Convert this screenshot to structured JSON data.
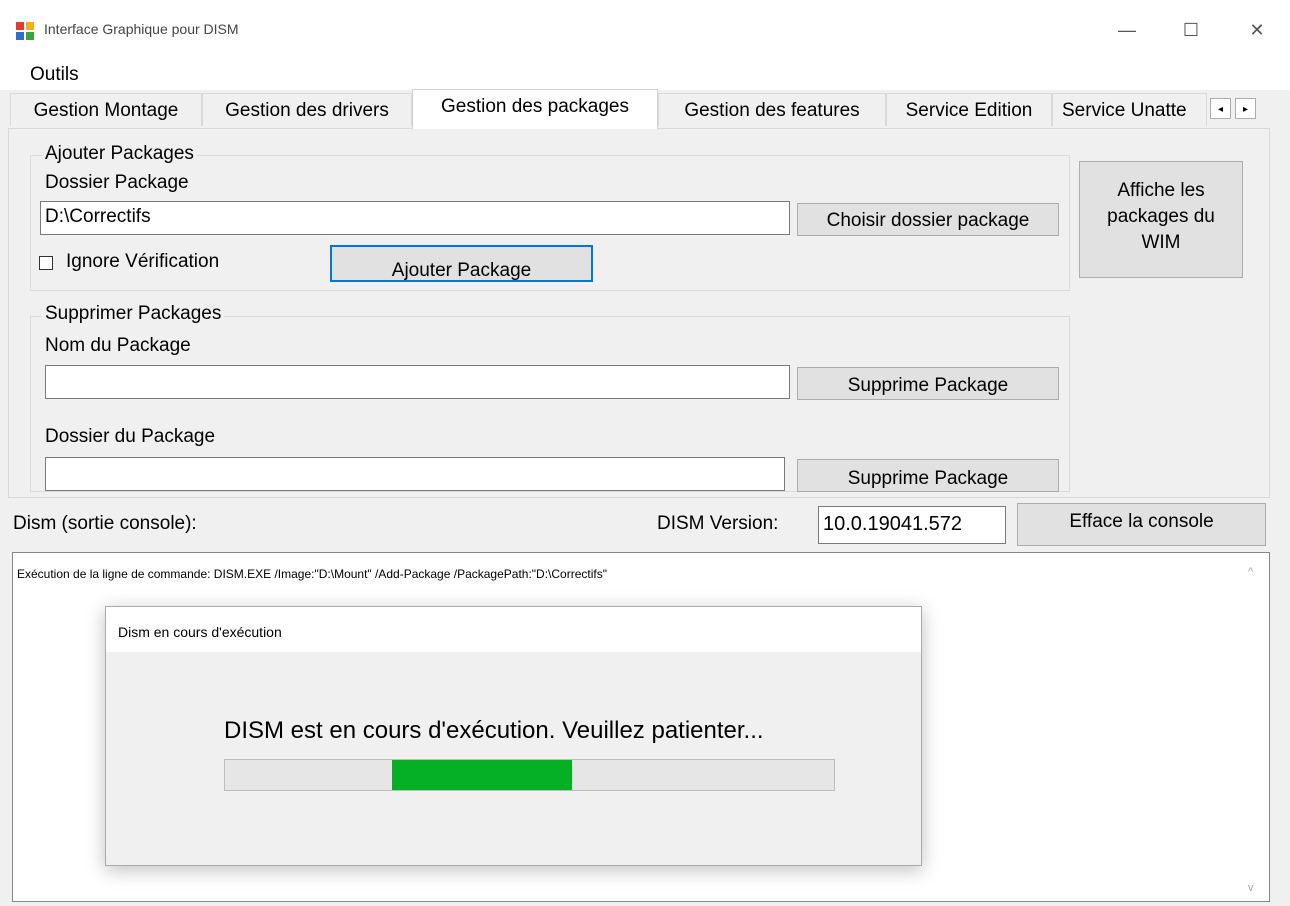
{
  "window": {
    "title": "Interface Graphique pour DISM",
    "minimize_glyph": "—",
    "maximize_glyph": "☐",
    "close_glyph": "✕"
  },
  "menu": {
    "items": [
      "Outils"
    ]
  },
  "tabs": [
    {
      "label": "Gestion Montage",
      "active": false
    },
    {
      "label": "Gestion des drivers",
      "active": false
    },
    {
      "label": "Gestion des packages",
      "active": true
    },
    {
      "label": "Gestion des features",
      "active": false
    },
    {
      "label": "Service Edition",
      "active": false
    },
    {
      "label": "Service Unatte",
      "active": false
    }
  ],
  "tab_scroll": {
    "left_glyph": "◂",
    "right_glyph": "▸"
  },
  "add_packages": {
    "group_title": "Ajouter Packages",
    "folder_label": "Dossier Package",
    "folder_value": "D:\\Correctifs",
    "choose_button": "Choisir dossier package",
    "ignore_check_label": "Ignore Vérification",
    "ignore_checked": false,
    "add_button": "Ajouter Package"
  },
  "show_packages_button": [
    "Affiche les",
    "packages du",
    "WIM"
  ],
  "remove_packages": {
    "group_title": "Supprimer Packages",
    "name_label": "Nom du Package",
    "name_value": "",
    "remove_button_1": "Supprime Package",
    "folder_label": "Dossier du Package",
    "folder_value": "",
    "remove_button_2": "Supprime Package"
  },
  "console": {
    "label": "Dism (sortie console):",
    "version_label": "DISM Version:",
    "version_value": "10.0.19041.572",
    "clear_button": "Efface la console",
    "output": "Exécution de la ligne de commande: DISM.EXE /Image:\"D:\\Mount\" /Add-Package /PackagePath:\"D:\\Correctifs\"",
    "scroll_up_glyph": "^",
    "scroll_down_glyph": "v"
  },
  "dialog": {
    "title": "Dism en cours d'exécution",
    "message": "DISM est en cours d'exécution. Veuillez patienter...",
    "progress_start": 0.275,
    "progress_end": 0.57,
    "progress_color": "#06b025"
  },
  "colors": {
    "accent": "#0078d7"
  }
}
